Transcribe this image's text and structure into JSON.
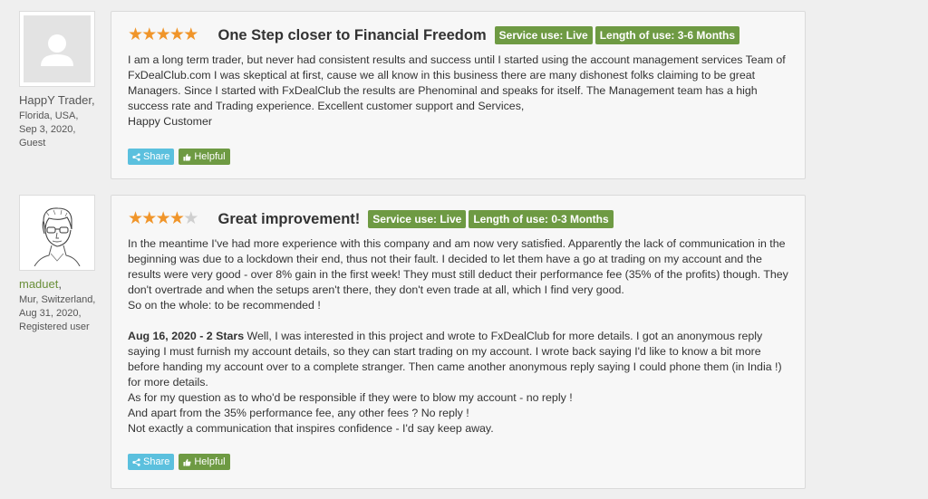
{
  "reviews": [
    {
      "author": {
        "name": "HappY Trader",
        "comma": ",",
        "location": "Florida, USA,",
        "date": "Sep 3, 2020,",
        "role": "Guest"
      },
      "rating": 5,
      "title": "One Step closer to Financial Freedom",
      "badges": [
        "Service use: Live",
        "Length of use: 3-6 Months"
      ],
      "body": [
        "I am a long term trader, but never had consistent results and success until I started using the account management services Team of FxDealClub.com I was skeptical at first, cause we all know in this business there are many dishonest folks claiming to be great Managers. Since I started with FxDealClub the results are Phenominal and speaks for itself. The Management team has a high success rate and Trading experience. Excellent customer support and Services,",
        "Happy Customer"
      ],
      "actions": {
        "share": "Share",
        "helpful": "Helpful"
      }
    },
    {
      "author": {
        "name": "maduet",
        "comma": ",",
        "location": "Mur, Switzerland,",
        "date": "Aug 31, 2020,",
        "role": "Registered user"
      },
      "rating": 4,
      "title": "Great improvement!",
      "badges": [
        "Service use: Live",
        "Length of use: 0-3 Months"
      ],
      "body": [
        "In the meantime I've had more experience with this company and am now very satisfied. Apparently the lack of communication in the beginning was due to a lockdown their end, thus not their fault. I decided to let them have a go at trading on my account and the results were very good - over 8% gain in the first week! They must still deduct their performance fee (35% of the profits) though. They don't overtrade and when the setups aren't there, they don't even trade at all, which I find very good.",
        "So on the whole: to be recommended !"
      ],
      "update": {
        "label": "Aug 16, 2020 - 2 Stars",
        "text": " Well, I was interested in this project and wrote to FxDealClub for more details. I got an anonymous reply saying I must furnish my account details, so they can start trading on my account. I wrote back saying I'd like to know a bit more before handing my account over to a complete stranger. Then came another anonymous reply saying I could phone them (in India !) for more details.",
        "lines": [
          "As for my question as to who'd be responsible if they were to blow my account - no reply !",
          "And apart from the 35% performance fee, any other fees ? No reply !",
          "Not exactly a communication that inspires confidence - I'd say keep away."
        ]
      },
      "actions": {
        "share": "Share",
        "helpful": "Helpful"
      }
    }
  ],
  "colors": {
    "star": "#f0952a",
    "star_off": "#cfcfcf",
    "badge": "#6e9a43",
    "share": "#5bc0de",
    "background": "#efefef"
  }
}
